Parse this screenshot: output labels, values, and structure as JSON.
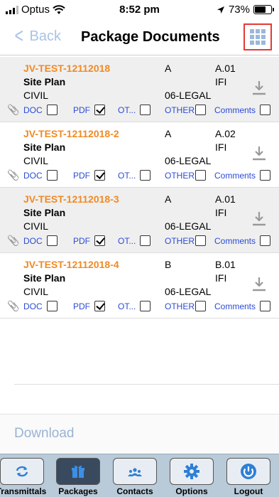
{
  "status_bar": {
    "carrier": "Optus",
    "time": "8:52 pm",
    "battery": "73%"
  },
  "nav": {
    "back_label": "Back",
    "title": "Package Documents"
  },
  "documents": [
    {
      "code": "JV-TEST-12112018",
      "title": "Site Plan",
      "discipline": "CIVIL",
      "revision": "A",
      "version": "A.01",
      "status": "IFI",
      "category": "06-LEGAL",
      "doc_label": "DOC",
      "pdf_label": "PDF",
      "ot_label": "OT...",
      "other_label": "OTHER",
      "comments_label": "Comments",
      "doc_checked": false,
      "pdf_checked": true,
      "ot_checked": false,
      "other_checked": false,
      "comments_checked": false
    },
    {
      "code": "JV-TEST-12112018-2",
      "title": "Site Plan",
      "discipline": "CIVIL",
      "revision": "A",
      "version": "A.02",
      "status": "IFI",
      "category": "06-LEGAL",
      "doc_label": "DOC",
      "pdf_label": "PDF",
      "ot_label": "OT...",
      "other_label": "OTHER",
      "comments_label": "Comments",
      "doc_checked": false,
      "pdf_checked": true,
      "ot_checked": false,
      "other_checked": false,
      "comments_checked": false
    },
    {
      "code": "JV-TEST-12112018-3",
      "title": "Site Plan",
      "discipline": "CIVIL",
      "revision": "A",
      "version": "A.01",
      "status": "IFI",
      "category": "06-LEGAL",
      "doc_label": "DOC",
      "pdf_label": "PDF",
      "ot_label": "OT...",
      "other_label": "OTHER",
      "comments_label": "Comments",
      "doc_checked": false,
      "pdf_checked": true,
      "ot_checked": false,
      "other_checked": false,
      "comments_checked": false
    },
    {
      "code": "JV-TEST-12112018-4",
      "title": "Site Plan",
      "discipline": "CIVIL",
      "revision": "B",
      "version": "B.01",
      "status": "IFI",
      "category": "06-LEGAL",
      "doc_label": "DOC",
      "pdf_label": "PDF",
      "ot_label": "OT...",
      "other_label": "OTHER",
      "comments_label": "Comments",
      "doc_checked": false,
      "pdf_checked": true,
      "ot_checked": false,
      "other_checked": false,
      "comments_checked": false
    }
  ],
  "download": {
    "label": "Download"
  },
  "tabs": [
    {
      "label": "Transmittals",
      "icon": "sync-icon"
    },
    {
      "label": "Packages",
      "icon": "gift-icon"
    },
    {
      "label": "Contacts",
      "icon": "people-icon"
    },
    {
      "label": "Options",
      "icon": "gear-icon"
    },
    {
      "label": "Logout",
      "icon": "power-icon"
    }
  ],
  "colors": {
    "accent": "#f08a24",
    "link": "#2b4bd6",
    "nav_tint": "#a8c3e6",
    "tabbar": "#b9cad9",
    "highlight": "#e53935"
  }
}
